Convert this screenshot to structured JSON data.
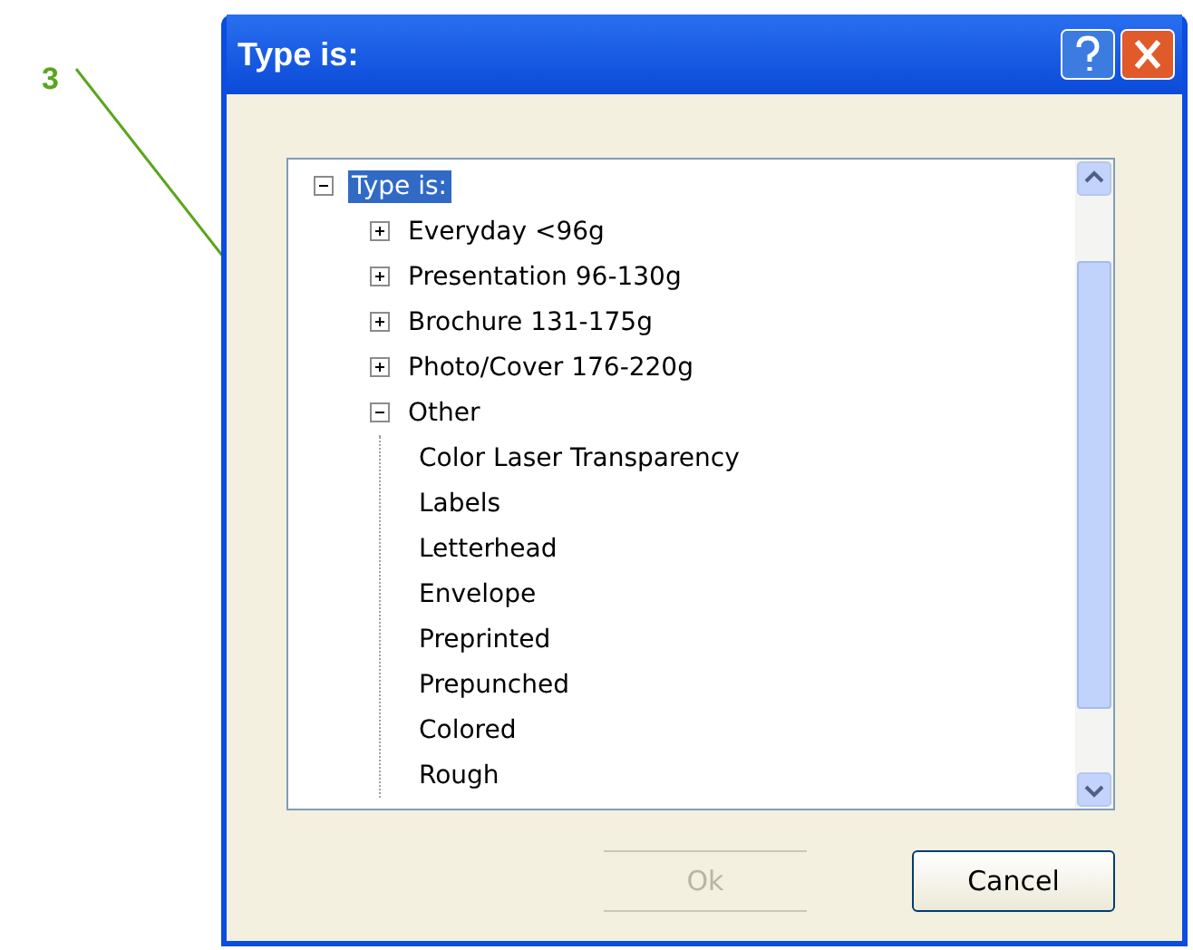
{
  "callout": {
    "label": "3"
  },
  "window": {
    "title": "Type is:"
  },
  "tree": {
    "label": "Type is:",
    "expanded": true,
    "selected": true,
    "children": [
      {
        "label": "Everyday <96g",
        "expanded": false,
        "selected": false
      },
      {
        "label": "Presentation 96-130g",
        "expanded": false,
        "selected": false
      },
      {
        "label": "Brochure 131-175g",
        "expanded": false,
        "selected": false
      },
      {
        "label": "Photo/Cover 176-220g",
        "expanded": false,
        "selected": false
      },
      {
        "label": "Other",
        "expanded": true,
        "selected": false,
        "children": [
          {
            "label": "Color Laser Transparency",
            "selected": false
          },
          {
            "label": "Labels",
            "selected": false
          },
          {
            "label": "Letterhead",
            "selected": false
          },
          {
            "label": "Envelope",
            "selected": false
          },
          {
            "label": "Preprinted",
            "selected": false
          },
          {
            "label": "Prepunched",
            "selected": false
          },
          {
            "label": "Colored",
            "selected": false
          },
          {
            "label": "Rough",
            "selected": false
          }
        ]
      }
    ]
  },
  "buttons": [
    {
      "label": "Ok",
      "disabled": true
    },
    {
      "label": "Cancel",
      "disabled": false
    }
  ]
}
